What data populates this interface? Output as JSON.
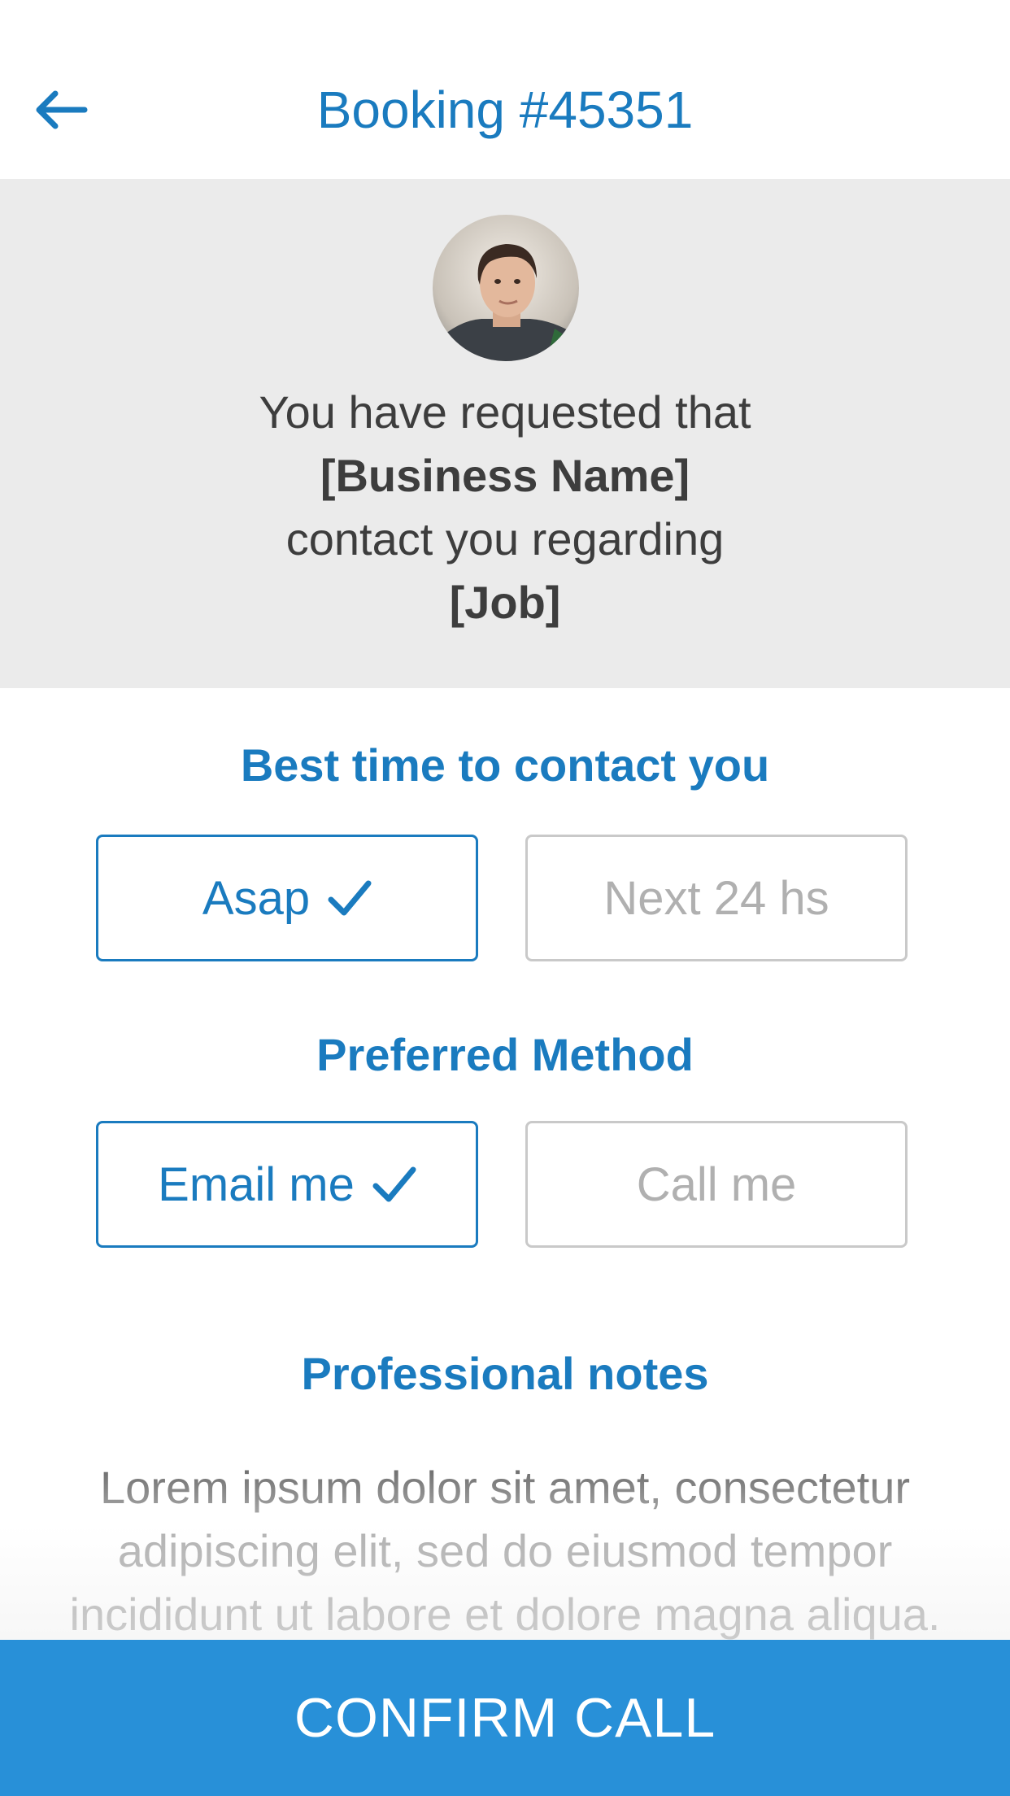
{
  "header": {
    "title": "Booking #45351",
    "back_icon": "arrow-left-icon"
  },
  "info": {
    "avatar_icon": "user-avatar",
    "line1": "You have requested that",
    "business": "[Business Name]",
    "line3": "contact you regarding",
    "job": "[Job]"
  },
  "contact_time": {
    "title": "Best time to contact you",
    "options": [
      {
        "label": "Asap",
        "selected": true
      },
      {
        "label": "Next 24 hs",
        "selected": false
      }
    ]
  },
  "method": {
    "title": "Preferred Method",
    "options": [
      {
        "label": "Email me",
        "selected": true
      },
      {
        "label": "Call me",
        "selected": false
      }
    ]
  },
  "notes": {
    "title": "Professional notes",
    "lines": [
      "Lorem ipsum dolor sit amet, consectetur",
      "adipiscing elit, sed do eiusmod tempor",
      "incididunt ut labore et dolore magna aliqua."
    ]
  },
  "confirm": {
    "label": "CONFIRM CALL"
  },
  "colors": {
    "accent": "#1a7bbf",
    "button": "#2890d8",
    "panel": "#ebebeb"
  }
}
